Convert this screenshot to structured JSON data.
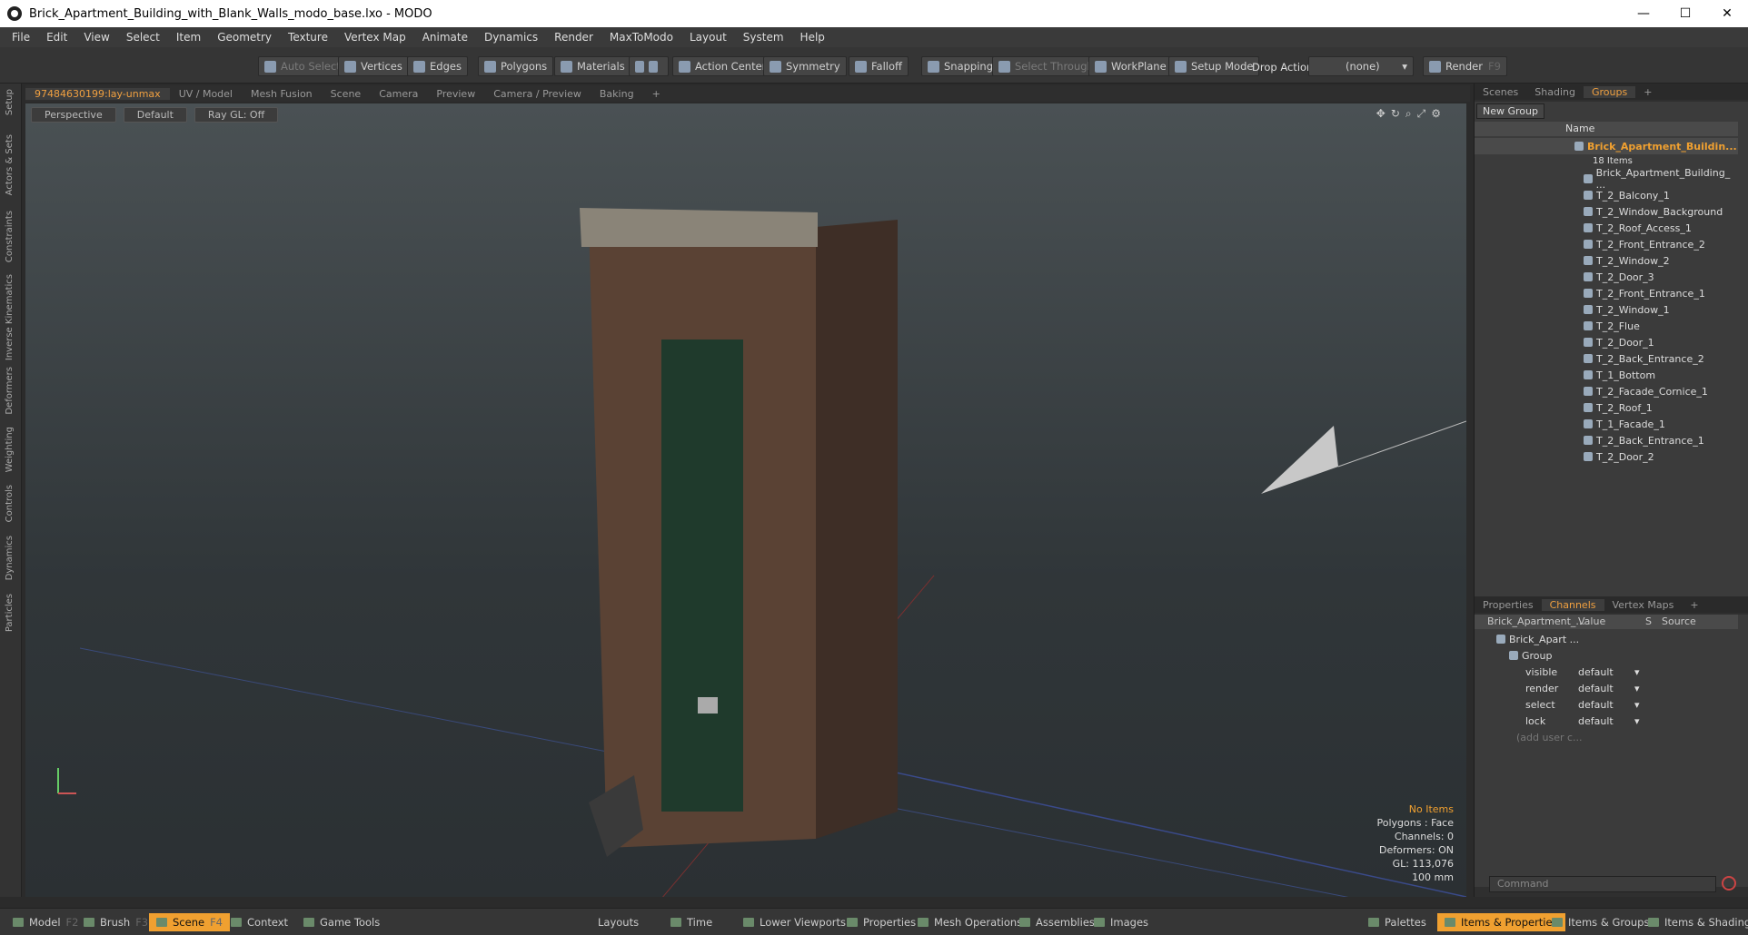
{
  "window": {
    "title": "Brick_Apartment_Building_with_Blank_Walls_modo_base.lxo - MODO",
    "min": "—",
    "max": "☐",
    "close": "✕"
  },
  "menu": [
    "File",
    "Edit",
    "View",
    "Select",
    "Item",
    "Geometry",
    "Texture",
    "Vertex Map",
    "Animate",
    "Dynamics",
    "Render",
    "MaxToModo",
    "Layout",
    "System",
    "Help"
  ],
  "toolbar": {
    "auto_select": "Auto Select",
    "vertices": "Vertices",
    "edges": "Edges",
    "polygons": "Polygons",
    "materials": "Materials",
    "action_center": "Action Center",
    "symmetry": "Symmetry",
    "falloff": "Falloff",
    "snapping": "Snapping",
    "select_through": "Select Through",
    "workplane": "WorkPlane",
    "setup_mode": "Setup Mode",
    "drop_action": "Drop Action",
    "drop_value": "(none)",
    "render": "Render",
    "render_key": "F9"
  },
  "left_tabs": [
    "Setup",
    "Actors & Sets",
    "Constraints",
    "Inverse Kinematics",
    "Deformers",
    "Weighting",
    "Controls",
    "Dynamics",
    "Particles"
  ],
  "viewport_tabs": [
    "97484630199:lay-unmax",
    "UV / Model",
    "Mesh Fusion",
    "Scene",
    "Camera",
    "Preview",
    "Camera / Preview",
    "Baking",
    "+"
  ],
  "viewport": {
    "view": "Perspective",
    "shading": "Default",
    "raygl": "Ray GL: Off"
  },
  "stats": {
    "items": "No Items",
    "polygons": "Polygons : Face",
    "channels": "Channels: 0",
    "deformers": "Deformers: ON",
    "gl": "GL: 113,076",
    "scale": "100 mm"
  },
  "groups_tabs": [
    "Scenes",
    "Shading",
    "Groups",
    "+"
  ],
  "groups": {
    "new_group": "New Group",
    "name_header": "Name",
    "root": "Brick_Apartment_Buildin...",
    "count": "18 Items",
    "items": [
      "Brick_Apartment_Building_ ...",
      "T_2_Balcony_1",
      "T_2_Window_Background",
      "T_2_Roof_Access_1",
      "T_2_Front_Entrance_2",
      "T_2_Window_2",
      "T_2_Door_3",
      "T_2_Front_Entrance_1",
      "T_2_Window_1",
      "T_2_Flue",
      "T_2_Door_1",
      "T_2_Back_Entrance_2",
      "T_1_Bottom",
      "T_2_Facade_Cornice_1",
      "T_2_Roof_1",
      "T_1_Facade_1",
      "T_2_Back_Entrance_1",
      "T_2_Door_2"
    ]
  },
  "props_tabs": [
    "Properties",
    "Channels",
    "Vertex Maps",
    "+"
  ],
  "channels": {
    "col_name": "Brick_Apartment_...",
    "col_value": "Value",
    "col_s": "S",
    "col_source": "Source",
    "item": "Brick_Apart ...",
    "group": "Group",
    "rows": [
      {
        "name": "visible",
        "value": "default"
      },
      {
        "name": "render",
        "value": "default"
      },
      {
        "name": "select",
        "value": "default"
      },
      {
        "name": "lock",
        "value": "default"
      }
    ],
    "add_user": "(add user c..."
  },
  "command": {
    "placeholder": "Command"
  },
  "bottom": {
    "model": "Model",
    "model_key": "F2",
    "brush": "Brush",
    "brush_key": "F3",
    "scene": "Scene",
    "scene_key": "F4",
    "context": "Context",
    "game_tools": "Game Tools",
    "layouts": "Layouts",
    "time": "Time",
    "lower_viewports": "Lower Viewports",
    "properties": "Properties",
    "mesh_operations": "Mesh Operations",
    "assemblies": "Assemblies",
    "images": "Images",
    "palettes": "Palettes",
    "items_properties": "Items & Properties",
    "items_groups": "Items & Groups",
    "items_shading": "Items & Shading"
  }
}
